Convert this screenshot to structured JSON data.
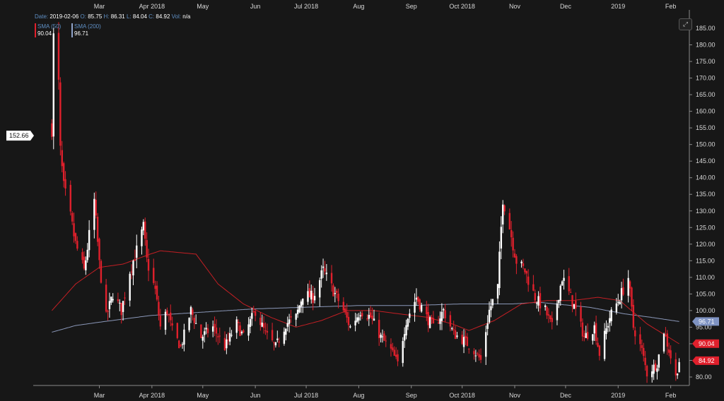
{
  "info": {
    "date_label": "Date:",
    "date": "2019-02-06",
    "o_label": "O:",
    "o": "85.75",
    "h_label": "H:",
    "h": "86.31",
    "l_label": "L:",
    "l": "84.04",
    "c_label": "C:",
    "c": "84.92",
    "vol_label": "Vol:",
    "vol": "n/a"
  },
  "legend": {
    "sma50_name": "SMA (50)",
    "sma50_value": "90.04",
    "sma200_name": "SMA (200)",
    "sma200_value": "96.71"
  },
  "chart_data": {
    "type": "candlestick",
    "ylim": [
      75,
      190
    ],
    "y_ticks": [
      80,
      85,
      90,
      95,
      100,
      105,
      110,
      115,
      120,
      125,
      130,
      135,
      140,
      145,
      150,
      155,
      160,
      165,
      170,
      175,
      180,
      185
    ],
    "y_tick_labels": [
      "80.00",
      "85.00",
      "90.00",
      "95.00",
      "100.00",
      "105.00",
      "110.00",
      "115.00",
      "120.00",
      "125.00",
      "130.00",
      "135.00",
      "140.00",
      "145.00",
      "150.00",
      "155.00",
      "160.00",
      "165.00",
      "170.00",
      "175.00",
      "180.00",
      "185.00"
    ],
    "x_month_labels": [
      "Mar",
      "Apr 2018",
      "May",
      "Jun",
      "Jul 2018",
      "Aug",
      "Sep",
      "Oct 2018",
      "Nov",
      "Dec",
      "2019",
      "Feb"
    ],
    "hover_price": "152.66",
    "last_price": "84.92",
    "sma50_label": "90.04",
    "sma200_label": "96.71",
    "colors": {
      "up": "#ffffff",
      "down": "#e0202c",
      "sma50": "#c41f24",
      "sma200": "#8a97b8",
      "background": "#171717",
      "last_price_bg": "#e0202c",
      "sma50_bg": "#e0202c",
      "sma200_bg": "#7f93c2"
    },
    "close_keypoints": [
      [
        "2018-02-01",
        155
      ],
      [
        "2018-02-02",
        182
      ],
      [
        "2018-02-05",
        168
      ],
      [
        "2018-02-06",
        148
      ],
      [
        "2018-02-08",
        137
      ],
      [
        "2018-02-12",
        128
      ],
      [
        "2018-02-15",
        120
      ],
      [
        "2018-02-20",
        112
      ],
      [
        "2018-02-26",
        133
      ],
      [
        "2018-03-01",
        114
      ],
      [
        "2018-03-05",
        98
      ],
      [
        "2018-03-09",
        105
      ],
      [
        "2018-03-14",
        100
      ],
      [
        "2018-03-19",
        112
      ],
      [
        "2018-03-23",
        118
      ],
      [
        "2018-03-27",
        125
      ],
      [
        "2018-03-29",
        115
      ],
      [
        "2018-04-03",
        106
      ],
      [
        "2018-04-06",
        95
      ],
      [
        "2018-04-10",
        100
      ],
      [
        "2018-04-13",
        94
      ],
      [
        "2018-04-18",
        89
      ],
      [
        "2018-04-24",
        100
      ],
      [
        "2018-04-30",
        92
      ],
      [
        "2018-05-07",
        95
      ],
      [
        "2018-05-14",
        89
      ],
      [
        "2018-05-21",
        96
      ],
      [
        "2018-05-25",
        92
      ],
      [
        "2018-06-01",
        100
      ],
      [
        "2018-06-07",
        93
      ],
      [
        "2018-06-13",
        89
      ],
      [
        "2018-06-19",
        96
      ],
      [
        "2018-06-25",
        98
      ],
      [
        "2018-06-29",
        105
      ],
      [
        "2018-07-05",
        104
      ],
      [
        "2018-07-11",
        112
      ],
      [
        "2018-07-17",
        106
      ],
      [
        "2018-07-23",
        100
      ],
      [
        "2018-07-27",
        95
      ],
      [
        "2018-08-02",
        100
      ],
      [
        "2018-08-08",
        98
      ],
      [
        "2018-08-14",
        92
      ],
      [
        "2018-08-20",
        88
      ],
      [
        "2018-08-24",
        84
      ],
      [
        "2018-08-29",
        97
      ],
      [
        "2018-09-04",
        104
      ],
      [
        "2018-09-10",
        98
      ],
      [
        "2018-09-14",
        95
      ],
      [
        "2018-09-20",
        100
      ],
      [
        "2018-09-26",
        93
      ],
      [
        "2018-10-02",
        91
      ],
      [
        "2018-10-08",
        88
      ],
      [
        "2018-10-12",
        85
      ],
      [
        "2018-10-17",
        100
      ],
      [
        "2018-10-22",
        107
      ],
      [
        "2018-10-25",
        134
      ],
      [
        "2018-10-29",
        125
      ],
      [
        "2018-11-02",
        115
      ],
      [
        "2018-11-07",
        112
      ],
      [
        "2018-11-13",
        104
      ],
      [
        "2018-11-19",
        100
      ],
      [
        "2018-11-23",
        95
      ],
      [
        "2018-11-29",
        110
      ],
      [
        "2018-12-04",
        104
      ],
      [
        "2018-12-07",
        100
      ],
      [
        "2018-12-12",
        92
      ],
      [
        "2018-12-18",
        95
      ],
      [
        "2018-12-21",
        87
      ],
      [
        "2018-12-27",
        98
      ],
      [
        "2019-01-02",
        104
      ],
      [
        "2019-01-07",
        110
      ],
      [
        "2019-01-10",
        95
      ],
      [
        "2019-01-15",
        88
      ],
      [
        "2019-01-18",
        81
      ],
      [
        "2019-01-24",
        84
      ],
      [
        "2019-01-28",
        94
      ],
      [
        "2019-01-31",
        88
      ],
      [
        "2019-02-04",
        80
      ],
      [
        "2019-02-06",
        84.92
      ]
    ],
    "sma50_keypoints": [
      [
        "2018-02-01",
        100
      ],
      [
        "2018-02-15",
        108
      ],
      [
        "2018-03-01",
        113
      ],
      [
        "2018-03-15",
        114
      ],
      [
        "2018-03-31",
        117
      ],
      [
        "2018-04-06",
        118
      ],
      [
        "2018-04-27",
        117
      ],
      [
        "2018-05-10",
        108
      ],
      [
        "2018-05-25",
        102
      ],
      [
        "2018-06-10",
        98
      ],
      [
        "2018-06-25",
        95
      ],
      [
        "2018-07-10",
        97
      ],
      [
        "2018-07-25",
        100
      ],
      [
        "2018-08-10",
        100
      ],
      [
        "2018-08-25",
        99
      ],
      [
        "2018-09-10",
        98
      ],
      [
        "2018-09-25",
        96
      ],
      [
        "2018-10-05",
        94
      ],
      [
        "2018-10-20",
        97
      ],
      [
        "2018-11-05",
        102
      ],
      [
        "2018-11-20",
        103
      ],
      [
        "2018-12-05",
        103
      ],
      [
        "2018-12-20",
        104
      ],
      [
        "2019-01-02",
        103
      ],
      [
        "2019-01-18",
        96
      ],
      [
        "2019-02-06",
        90
      ]
    ],
    "sma200_keypoints": [
      [
        "2018-02-01",
        93.5
      ],
      [
        "2018-02-15",
        95.5
      ],
      [
        "2018-03-01",
        96.5
      ],
      [
        "2018-03-31",
        98.5
      ],
      [
        "2018-04-30",
        99.5
      ],
      [
        "2018-05-31",
        100.5
      ],
      [
        "2018-06-30",
        101
      ],
      [
        "2018-07-31",
        101.5
      ],
      [
        "2018-08-31",
        101.5
      ],
      [
        "2018-09-30",
        102
      ],
      [
        "2018-10-31",
        102
      ],
      [
        "2018-11-15",
        102.5
      ],
      [
        "2018-12-15",
        101
      ],
      [
        "2019-01-05",
        99
      ],
      [
        "2019-01-20",
        98
      ],
      [
        "2019-02-06",
        96.71
      ]
    ]
  }
}
